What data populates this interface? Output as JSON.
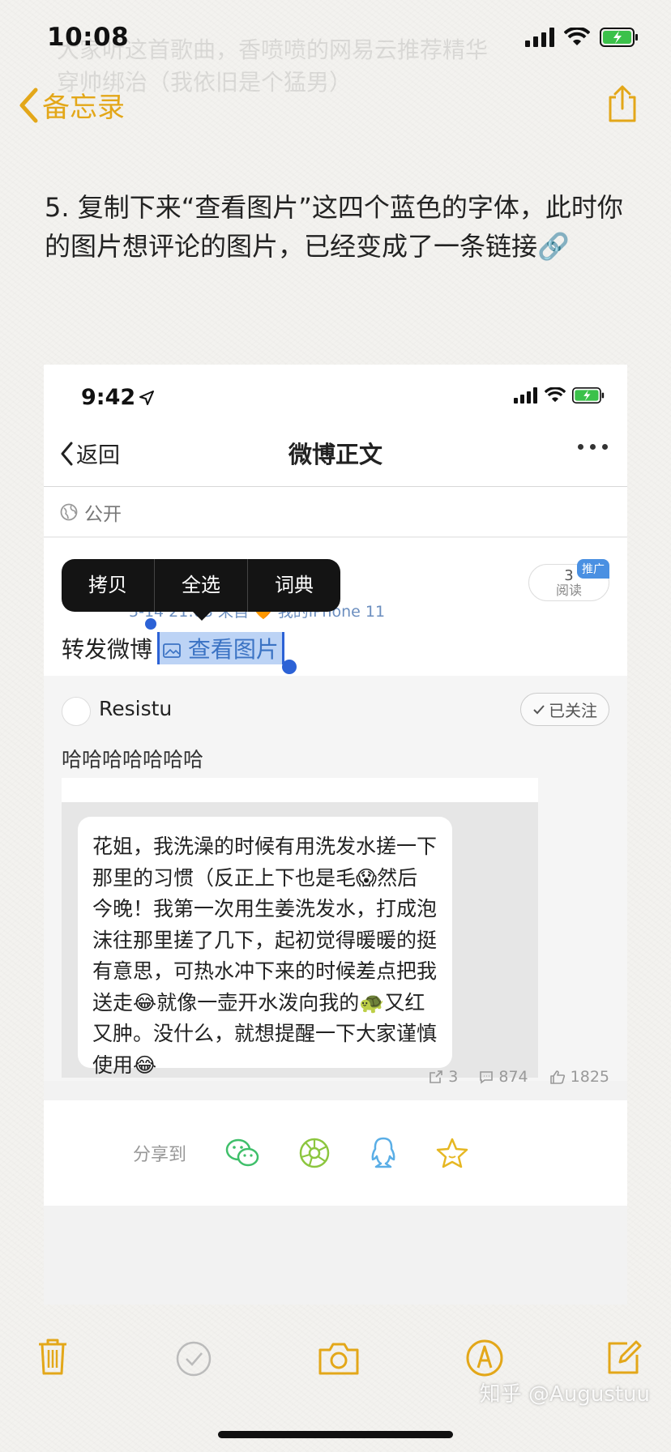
{
  "status_bar": {
    "time": "10:08"
  },
  "ghost_text": {
    "line1": "大家听这首歌曲，香喷喷的网易云推荐精华",
    "line2": "穿帅绑治（我依旧是个猛男）"
  },
  "nav": {
    "back_label": "备忘录"
  },
  "note_body": "5. 复制下来“查看图片”这四个蓝色的字体，此时你的图片想评论的图片，已经变成了一条链接🔗",
  "embedded": {
    "status_time": "9:42",
    "back_label": "返回",
    "title": "微博正文",
    "visibility": "公开",
    "context_menu": [
      "拷贝",
      "全选",
      "词典"
    ],
    "meta": "5-14 21:03 来自 🧡 我的iPhone 11",
    "read_count": "3",
    "read_label": "阅读",
    "promo_tag": "推广",
    "retweet_prefix": "转发微博",
    "selected_link": "查看图片",
    "reposter": {
      "name": "Resistu",
      "follow_label": "已关注",
      "text": "哈哈哈哈哈哈哈"
    },
    "image_text": "花姐，我洗澡的时候有用洗发水搓一下那里的习惯（反正上下也是毛😱然后今晚！我第一次用生姜洗发水，打成泡沫往那里搓了几下，起初觉得暖暖的挺有意思，可热水冲下来的时候差点把我送走😂就像一壶开水泼向我的🐢又红又肿。没什么，就想提醒一下大家谨慎使用😂",
    "stats": {
      "reposts": "3",
      "comments": "874",
      "likes": "1825"
    },
    "share_label": "分享到"
  },
  "watermark": "知乎 @Augustuu",
  "colors": {
    "notes_accent": "#e3a719",
    "link_blue": "#3b73c4",
    "selection": "#bcd3f5"
  }
}
